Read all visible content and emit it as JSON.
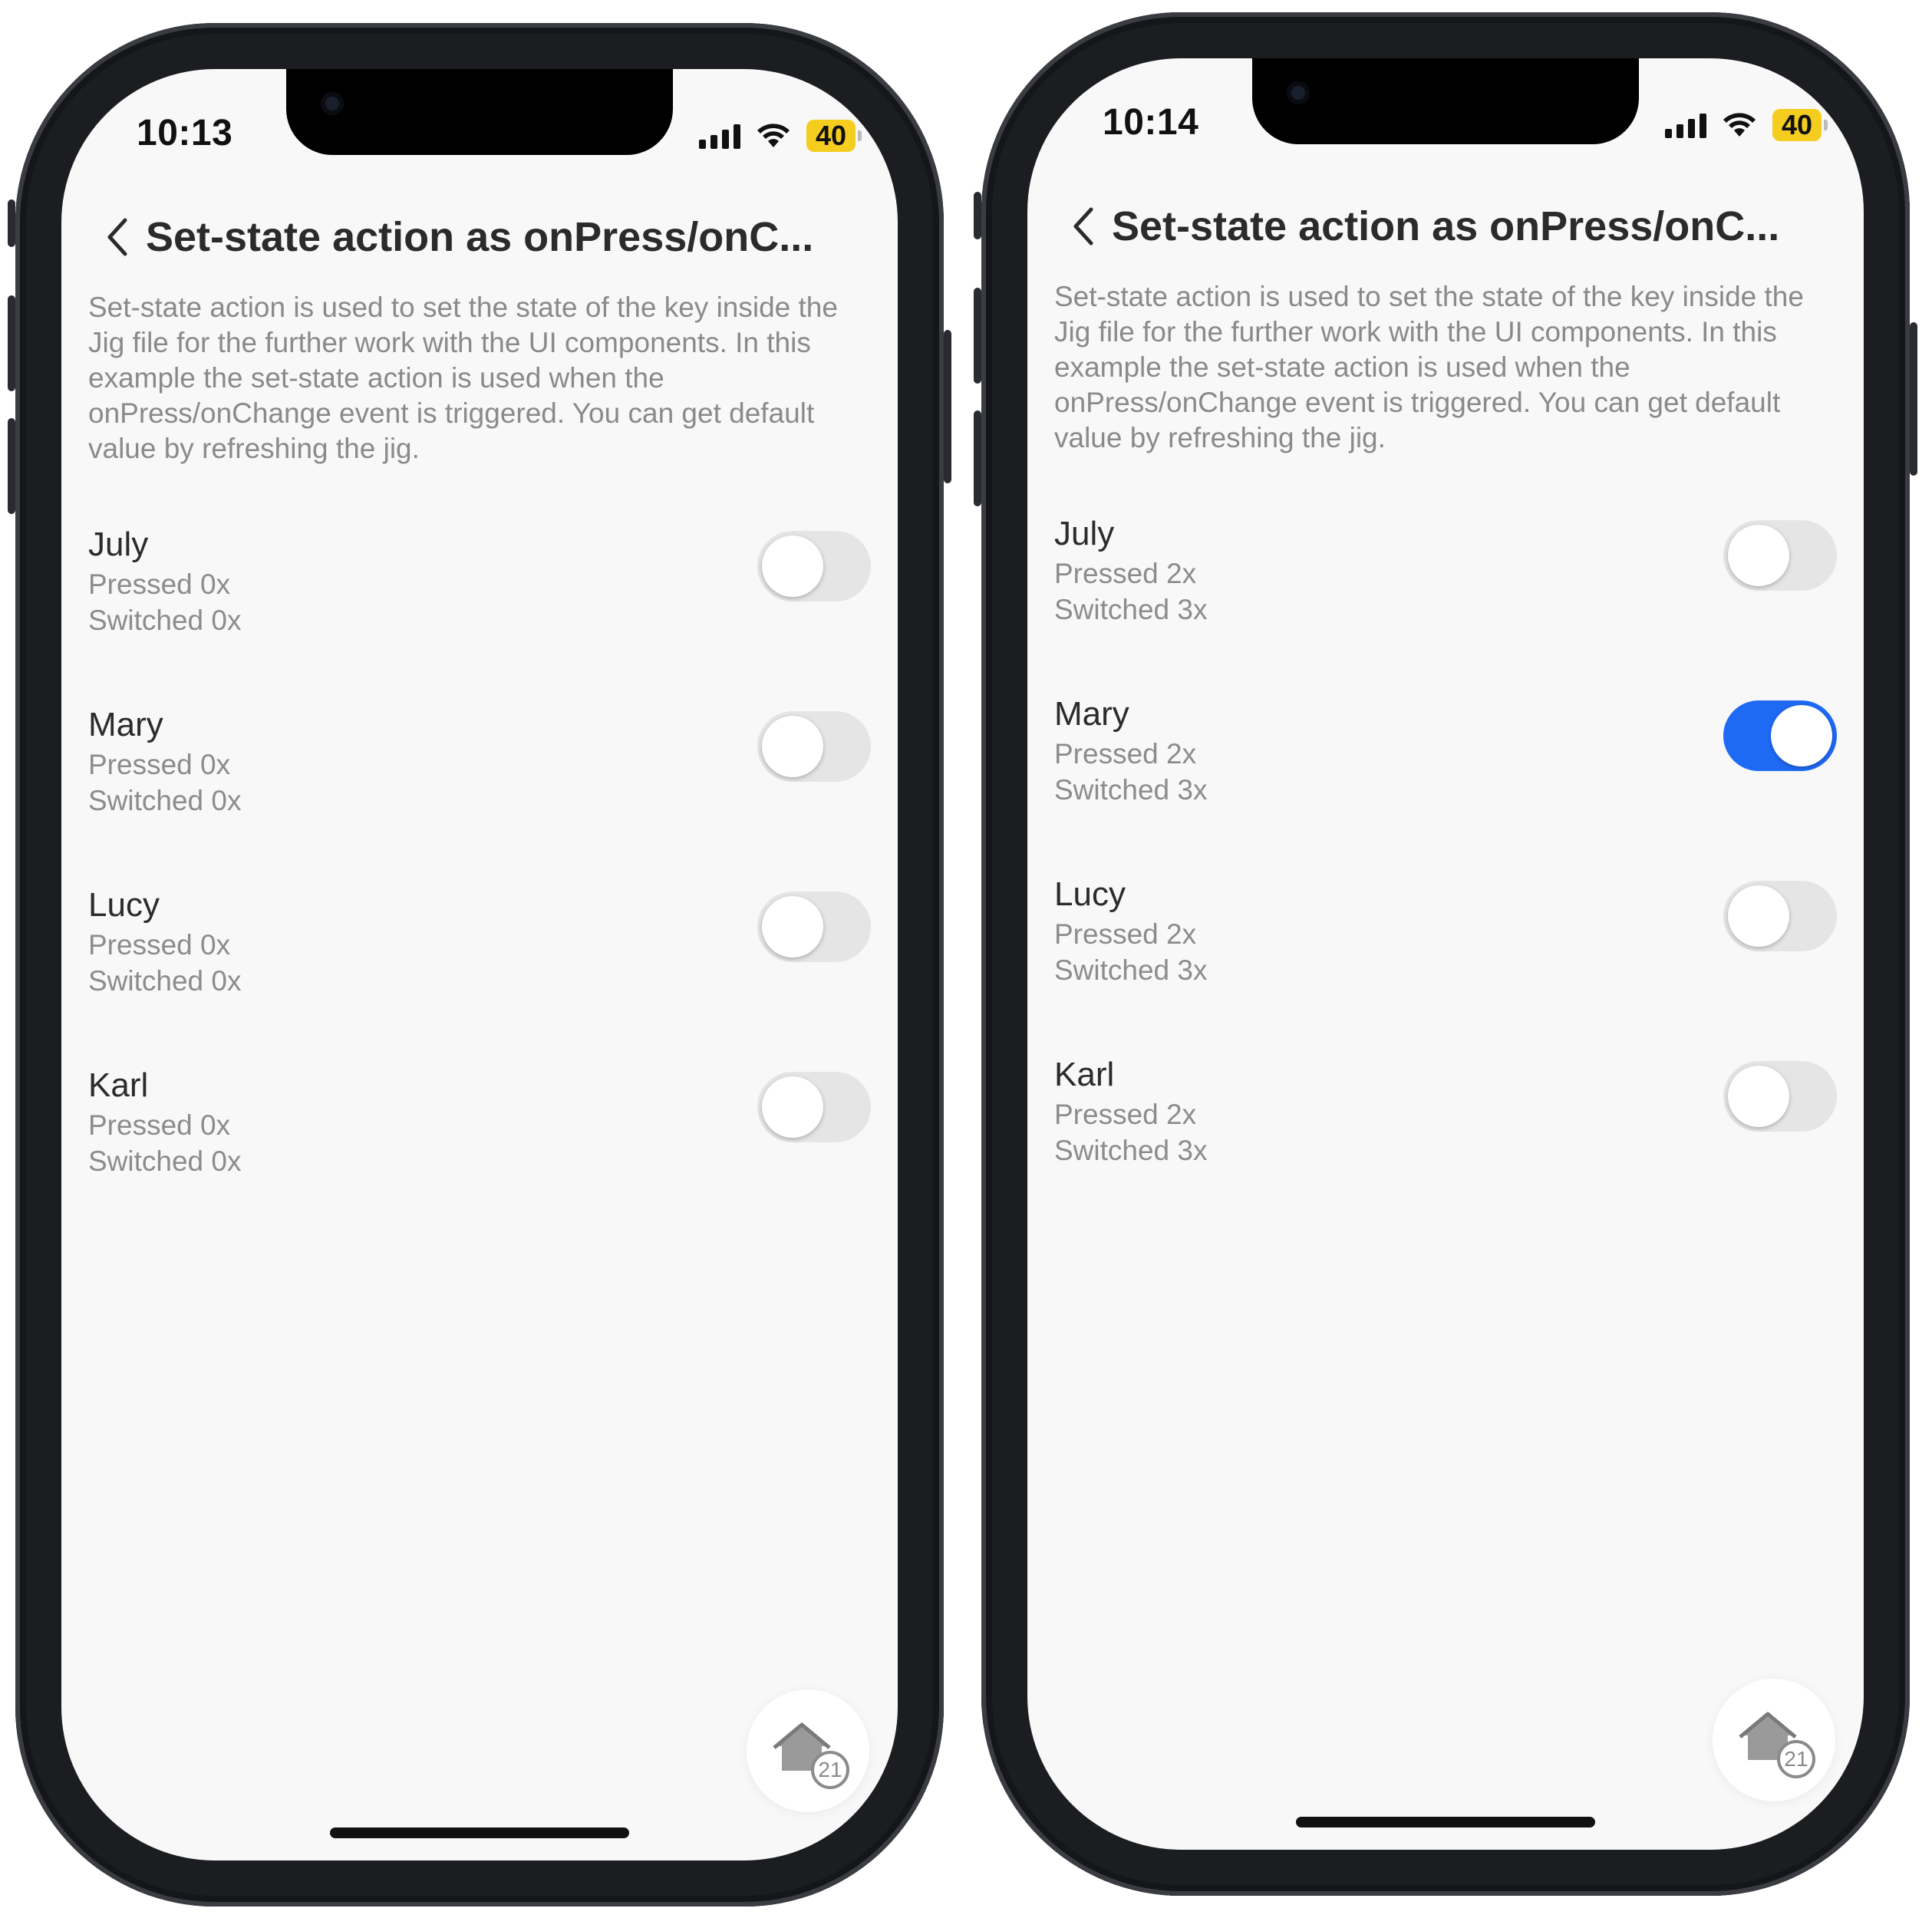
{
  "screens": [
    {
      "status": {
        "time": "10:13",
        "battery": "40"
      },
      "header": {
        "title": "Set-state action as onPress/onC..."
      },
      "description": "Set-state action is used to set the state of the key inside the Jig file for the further work with the UI components. In this example the set-state action is used when the onPress/onChange event is triggered. You can get default value by refreshing the jig.",
      "items": [
        {
          "name": "July",
          "pressed": "Pressed 0x",
          "switched": "Switched 0x",
          "on": false
        },
        {
          "name": "Mary",
          "pressed": "Pressed 0x",
          "switched": "Switched 0x",
          "on": false
        },
        {
          "name": "Lucy",
          "pressed": "Pressed 0x",
          "switched": "Switched 0x",
          "on": false
        },
        {
          "name": "Karl",
          "pressed": "Pressed 0x",
          "switched": "Switched 0x",
          "on": false
        }
      ],
      "fab": {
        "icon": "home-icon",
        "badge": "21"
      }
    },
    {
      "status": {
        "time": "10:14",
        "battery": "40"
      },
      "header": {
        "title": "Set-state action as onPress/onC..."
      },
      "description": "Set-state action is used to set the state of the key inside the Jig file for the further work with the UI components. In this example the set-state action is used when the onPress/onChange event is triggered. You can get default value by refreshing the jig.",
      "items": [
        {
          "name": "July",
          "pressed": "Pressed 2x",
          "switched": "Switched 3x",
          "on": false
        },
        {
          "name": "Mary",
          "pressed": "Pressed 2x",
          "switched": "Switched 3x",
          "on": true
        },
        {
          "name": "Lucy",
          "pressed": "Pressed 2x",
          "switched": "Switched 3x",
          "on": false
        },
        {
          "name": "Karl",
          "pressed": "Pressed 2x",
          "switched": "Switched 3x",
          "on": false
        }
      ],
      "fab": {
        "icon": "home-icon",
        "badge": "21"
      }
    }
  ],
  "colors": {
    "toggle_on": "#1f6af5",
    "toggle_off": "#e5e5e5",
    "battery": "#f4cd1f",
    "background": "#f8f8f8"
  }
}
